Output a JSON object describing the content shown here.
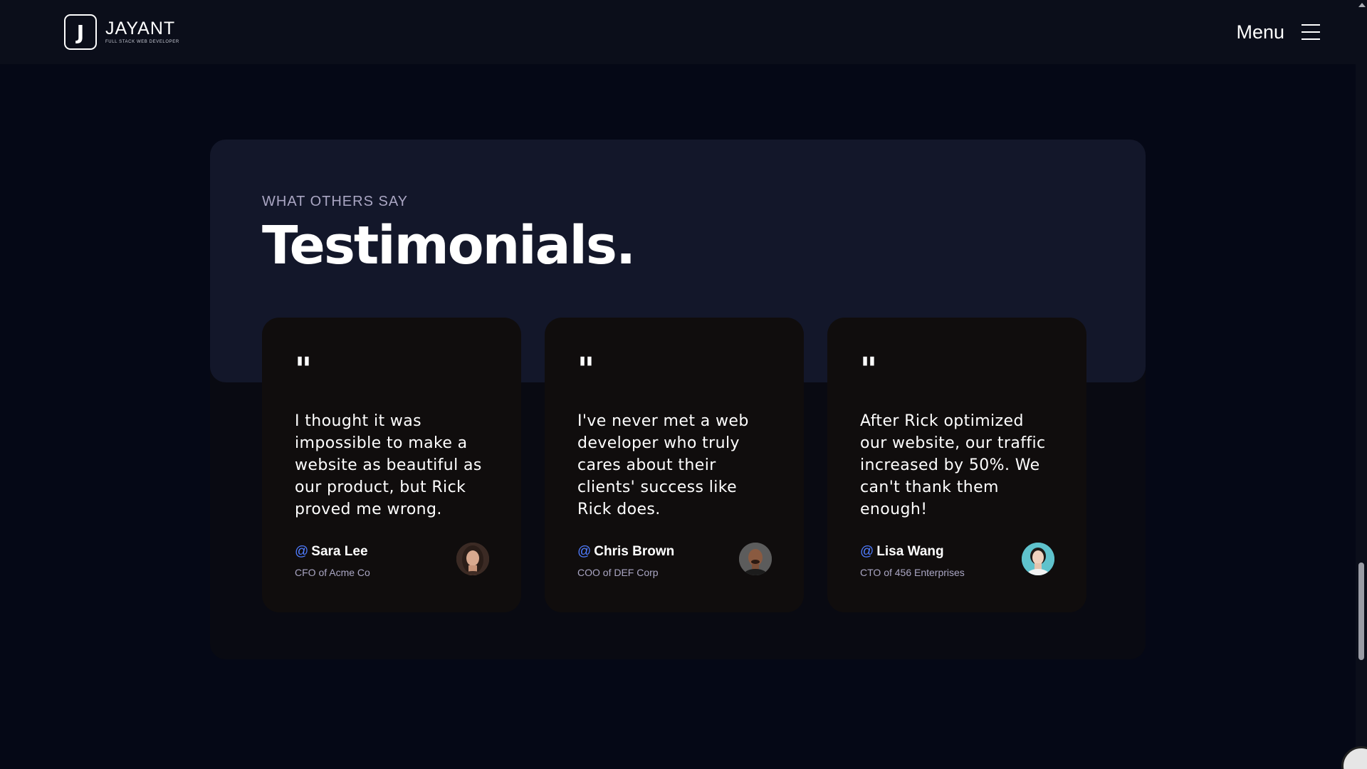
{
  "header": {
    "logo_letter": "J",
    "logo_name": "JAYANT",
    "logo_tagline": "FULL STACK WEB DEVELOPER",
    "menu_label": "Menu"
  },
  "testimonials": {
    "eyebrow": "WHAT OTHERS SAY",
    "heading": "Testimonials.",
    "quote_glyph": "\"",
    "at_symbol": "@",
    "cards": [
      {
        "quote": "I thought it was impossible to make a website as beautiful as our product, but Rick proved me wrong.",
        "name": "Sara Lee",
        "title": "CFO of Acme Co",
        "avatar": "woman-portrait"
      },
      {
        "quote": "I've never met a web developer who truly cares about their clients' success like Rick does.",
        "name": "Chris Brown",
        "title": "COO of DEF Corp",
        "avatar": "man-portrait"
      },
      {
        "quote": "After Rick optimized our website, our traffic increased by 50%. We can't thank them enough!",
        "name": "Lisa Wang",
        "title": "CTO of 456 Enterprises",
        "avatar": "woman-portrait"
      }
    ]
  },
  "colors": {
    "page_background": "#050816",
    "section_head": "#13172a",
    "card_background": "#100d0d",
    "secondary_text": "#aaa6c3",
    "accent_at": "#4f7cff"
  }
}
